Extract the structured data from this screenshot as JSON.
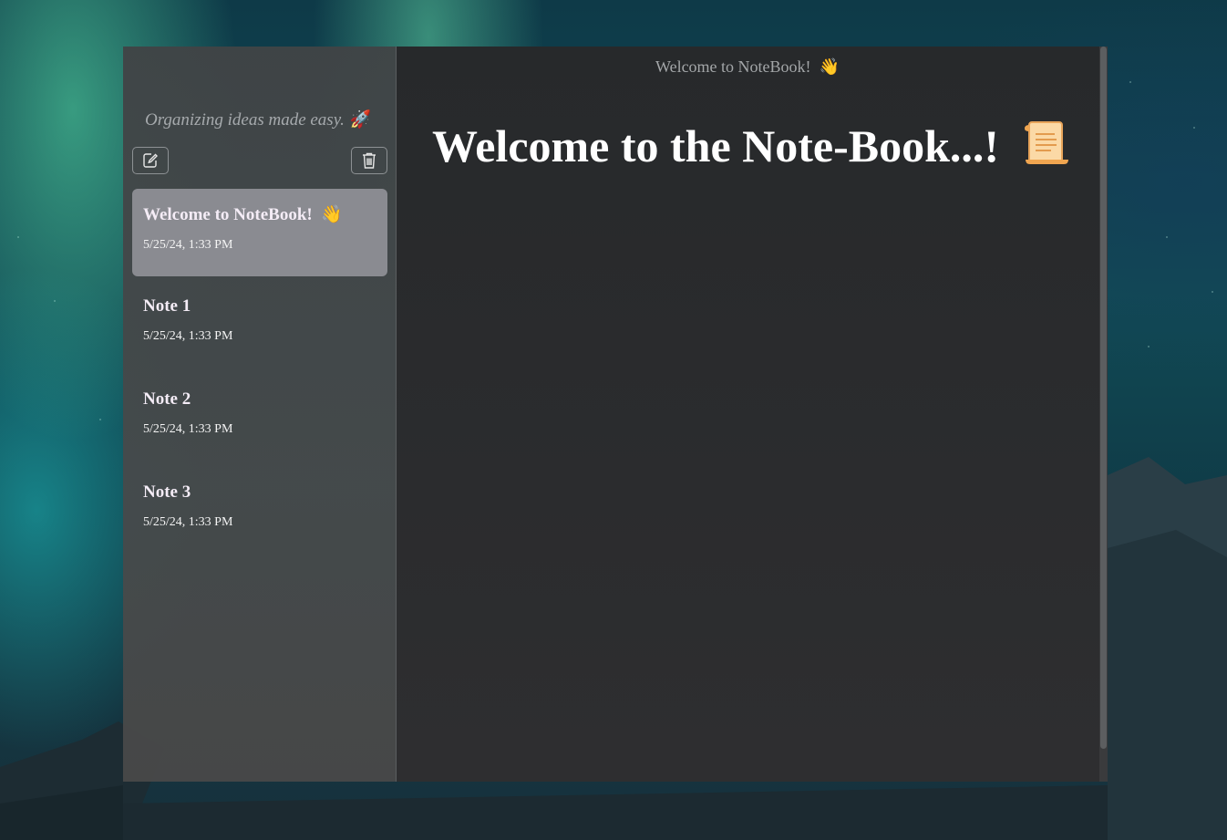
{
  "sidebar": {
    "tagline": "Organizing ideas made easy.",
    "tagline_emoji": "🚀",
    "new_note_icon": "edit-note-icon",
    "delete_icon": "trash-icon",
    "notes": [
      {
        "title": "Welcome to NoteBook!",
        "emoji": "👋",
        "date": "5/25/24, 1:33 PM",
        "active": true
      },
      {
        "title": "Note 1",
        "emoji": "",
        "date": "5/25/24, 1:33 PM",
        "active": false
      },
      {
        "title": "Note 2",
        "emoji": "",
        "date": "5/25/24, 1:33 PM",
        "active": false
      },
      {
        "title": "Note 3",
        "emoji": "",
        "date": "5/25/24, 1:33 PM",
        "active": false
      }
    ]
  },
  "editor": {
    "header_title": "Welcome to NoteBook!",
    "header_emoji": "👋",
    "heading": "Welcome to the Note-Book...!",
    "heading_icon": "scroll-icon"
  },
  "colors": {
    "active_note_bg": "#8a8b91",
    "sidebar_bg": "#43474a",
    "editor_bg": "#2a2b2d",
    "scroll_icon": "#f4b56a"
  }
}
